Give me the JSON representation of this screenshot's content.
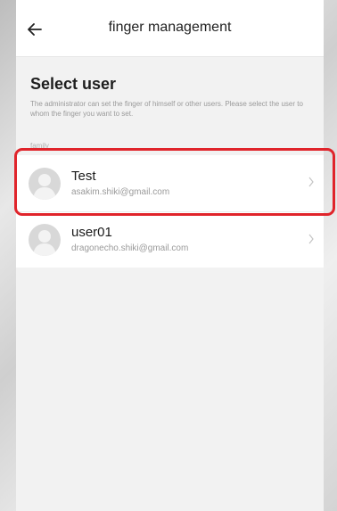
{
  "header": {
    "title": "finger management"
  },
  "section": {
    "title": "Select user",
    "description": "The administrator can set the finger of himself or other users. Please select the user to whom the finger you want to set."
  },
  "group": {
    "label": "family"
  },
  "users": [
    {
      "name": "Test",
      "email": "asakim.shiki@gmail.com"
    },
    {
      "name": "user01",
      "email": "dragonecho.shiki@gmail.com"
    }
  ],
  "icons": {
    "back": "back-arrow-icon",
    "avatar": "user-avatar-icon",
    "chevron": "chevron-right-icon"
  },
  "colors": {
    "highlight": "#e0242b",
    "background": "#f2f2f2"
  }
}
